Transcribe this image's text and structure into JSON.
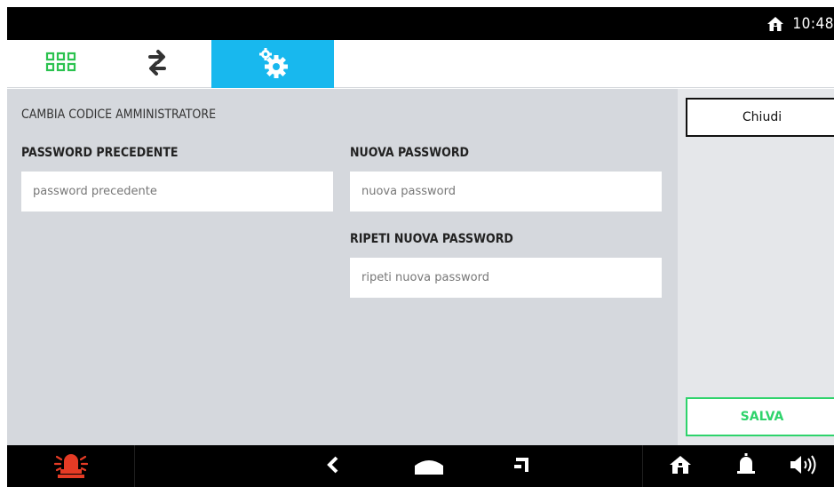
{
  "status_bar": {
    "time": "10:48",
    "home_icon": "home-icon"
  },
  "tabs": [
    {
      "name": "apps",
      "icon": "grid-icon",
      "color": "#2bc24f"
    },
    {
      "name": "transfer",
      "icon": "swap-arrows-icon",
      "color": "#333333"
    },
    {
      "name": "settings",
      "icon": "gears-icon",
      "active": true,
      "color": "#18b8ee"
    }
  ],
  "form": {
    "title": "CAMBIA CODICE AMMINISTRATORE",
    "old_password": {
      "label": "PASSWORD PRECEDENTE",
      "placeholder": "password precedente",
      "value": ""
    },
    "new_password": {
      "label": "NUOVA PASSWORD",
      "placeholder": "nuova password",
      "value": ""
    },
    "repeat_password": {
      "label": "RIPETI NUOVA PASSWORD",
      "placeholder": "ripeti nuova password",
      "value": ""
    }
  },
  "side_panel": {
    "close_label": "Chiudi",
    "save_label": "SALVA",
    "save_color": "#2ed36b"
  },
  "nav_bar": {
    "items": [
      "alarm-icon",
      "back-icon",
      "home-icon",
      "recents-icon",
      "home-icon",
      "bell-icon",
      "volume-icon"
    ],
    "alarm_color": "#e53b25"
  }
}
